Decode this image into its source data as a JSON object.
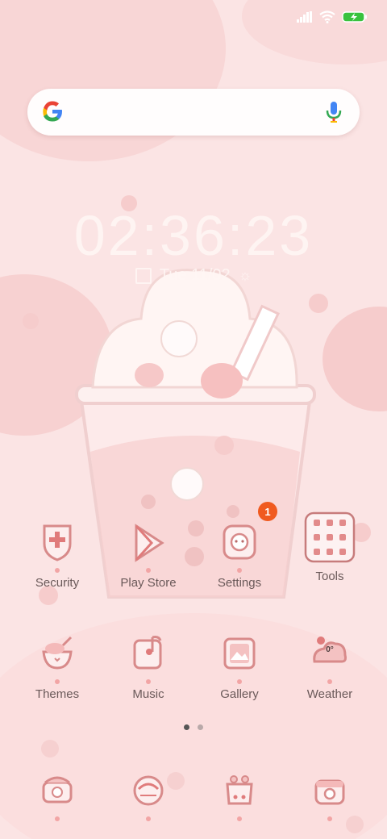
{
  "status_bar": {
    "signal_icon": "signal-icon",
    "wifi_icon": "wifi-icon",
    "battery_icon": "battery-charging-icon",
    "battery_color": "#39c23e"
  },
  "search": {
    "logo_icon": "google-g-icon",
    "mic_icon": "microphone-icon"
  },
  "clock": {
    "time": "02:36:23",
    "date": "Tue 11/02"
  },
  "apps_row1": [
    {
      "label": "Security",
      "icon": "shield-icon"
    },
    {
      "label": "Play Store",
      "icon": "play-store-icon"
    },
    {
      "label": "Settings",
      "icon": "gear-icon",
      "badge": "1"
    },
    {
      "label": "Tools",
      "icon": "tools-folder-icon"
    }
  ],
  "apps_row2": [
    {
      "label": "Themes",
      "icon": "themes-icon"
    },
    {
      "label": "Music",
      "icon": "music-icon"
    },
    {
      "label": "Gallery",
      "icon": "gallery-icon"
    },
    {
      "label": "Weather",
      "icon": "weather-icon",
      "temp": "0°"
    }
  ],
  "pager": {
    "pages": 2,
    "active": 1
  },
  "dock": [
    {
      "icon": "phone-icon"
    },
    {
      "icon": "messages-icon"
    },
    {
      "icon": "browser-icon"
    },
    {
      "icon": "camera-icon"
    }
  ],
  "colors": {
    "accent": "#e28b8b",
    "background": "#fbe4e4",
    "badge": "#f05a1f"
  }
}
